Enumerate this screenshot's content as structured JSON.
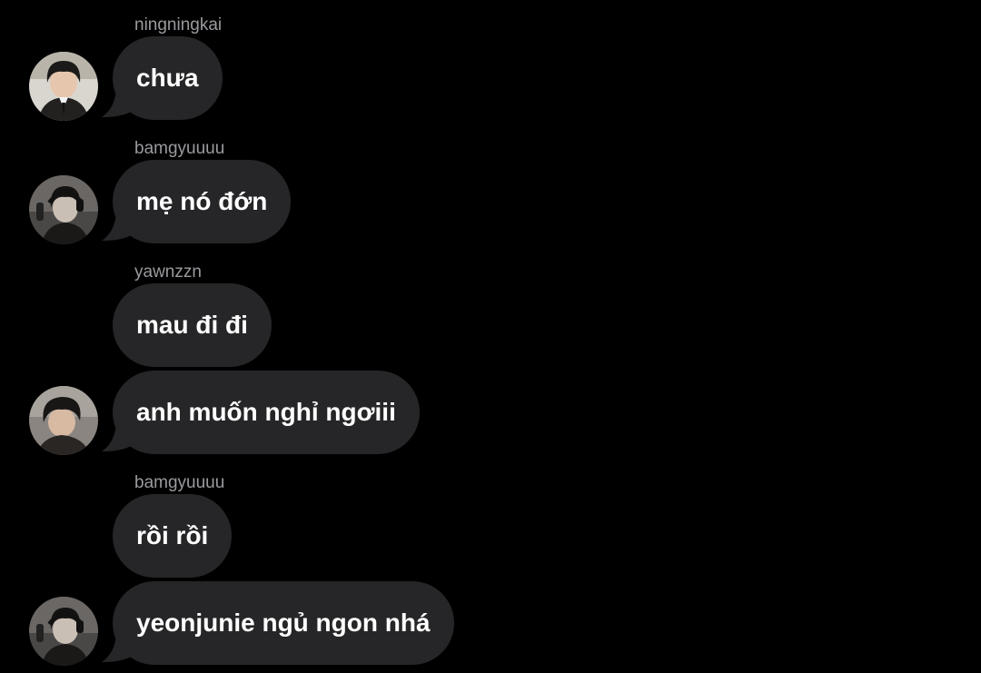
{
  "messages": [
    {
      "sender": "ningningkai",
      "text": "chưa",
      "avatar": "avatar-ningningkai"
    },
    {
      "sender": "bamgyuuuu",
      "text": "mẹ nó đớn",
      "avatar": "avatar-bamgyuuuu"
    },
    {
      "sender": "yawnzzn",
      "text": "mau đi đi"
    },
    {
      "text": "anh muốn nghỉ ngơiii",
      "avatar": "avatar-yawnzzn"
    },
    {
      "sender": "bamgyuuuu",
      "text": "rồi rồi"
    },
    {
      "text": "yeonjunie ngủ ngon nhá",
      "avatar": "avatar-bamgyuuuu"
    }
  ],
  "colors": {
    "background": "#000000",
    "bubble": "#262628",
    "sender_text": "#9a9a9f",
    "message_text": "#ffffff"
  }
}
